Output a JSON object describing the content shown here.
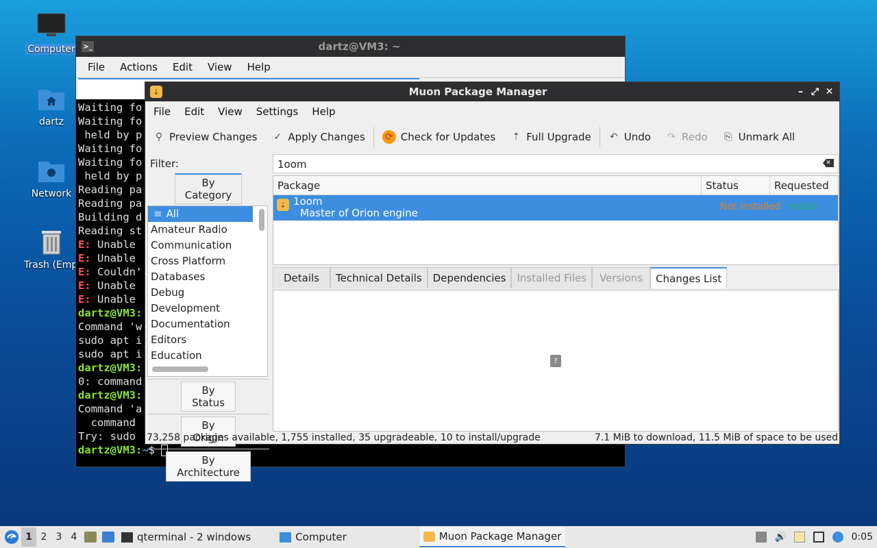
{
  "desktop": {
    "icons": [
      {
        "label": "Computer"
      },
      {
        "label": "dartz"
      },
      {
        "label": "Network"
      },
      {
        "label": "Trash (Empty)"
      }
    ]
  },
  "terminal": {
    "title": "dartz@VM3: ~",
    "menu": [
      "File",
      "Actions",
      "Edit",
      "View",
      "Help"
    ],
    "lines": [
      {
        "type": "plain",
        "text": "Waiting fo"
      },
      {
        "type": "plain",
        "text": "Waiting fo"
      },
      {
        "type": "plain",
        "text": " held by p"
      },
      {
        "type": "plain",
        "text": "Waiting fo"
      },
      {
        "type": "plain",
        "text": "Waiting fo"
      },
      {
        "type": "plain",
        "text": " held by p"
      },
      {
        "type": "plain",
        "text": "Reading pa"
      },
      {
        "type": "plain",
        "text": "Reading pa"
      },
      {
        "type": "plain",
        "text": "Building d"
      },
      {
        "type": "plain",
        "text": "Reading st"
      },
      {
        "type": "err",
        "prefix": "E:",
        "text": " Unable"
      },
      {
        "type": "err",
        "prefix": "E:",
        "text": " Unable"
      },
      {
        "type": "err",
        "prefix": "E:",
        "text": " Couldn'"
      },
      {
        "type": "err",
        "prefix": "E:",
        "text": " Unable"
      },
      {
        "type": "err",
        "prefix": "E:",
        "text": " Unable"
      },
      {
        "type": "prompt",
        "prefix": "dartz@VM3:",
        "text": ""
      },
      {
        "type": "plain",
        "text": "Command 'w"
      },
      {
        "type": "plain",
        "text": "sudo apt i"
      },
      {
        "type": "plain",
        "text": "sudo apt i"
      },
      {
        "type": "prompt",
        "prefix": "dartz@VM3:",
        "text": ""
      },
      {
        "type": "plain",
        "text": "0: command"
      },
      {
        "type": "prompt",
        "prefix": "dartz@VM3:",
        "text": ""
      },
      {
        "type": "plain",
        "text": "Command 'a"
      },
      {
        "type": "plain",
        "text": "  command"
      },
      {
        "type": "plain",
        "text": "Try: sudo"
      }
    ],
    "final_prompt": {
      "user": "dartz@VM3:",
      "path": "~",
      "symbol": "$ "
    }
  },
  "muon": {
    "title": "Muon Package Manager",
    "window_buttons": {
      "min": "–",
      "max": "⤢",
      "close": "✕"
    },
    "menu": [
      "File",
      "Edit",
      "View",
      "Settings",
      "Help"
    ],
    "toolbar": {
      "preview": "Preview Changes",
      "apply": "Apply Changes",
      "check": "Check for Updates",
      "upgrade": "Full Upgrade",
      "undo": "Undo",
      "redo": "Redo",
      "unmark": "Unmark All"
    },
    "filter_label": "Filter:",
    "tabs": {
      "category": "By Category",
      "status": "By Status",
      "origin": "By Origin",
      "arch": "By Architecture"
    },
    "categories": [
      "All",
      "Amateur Radio",
      "Communication",
      "Cross Platform",
      "Databases",
      "Debug",
      "Development",
      "Documentation",
      "Editors",
      "Education"
    ],
    "search_value": "1oom",
    "columns": {
      "package": "Package",
      "status": "Status",
      "requested": "Requested"
    },
    "row": {
      "name": "1oom",
      "description": "Master of Orion engine",
      "status": "Not installed",
      "requested": "Install"
    },
    "detail_tabs": [
      "Details",
      "Technical Details",
      "Dependencies",
      "Installed Files",
      "Versions",
      "Changes List"
    ],
    "statusbar": {
      "left": "73,258 packages available, 1,755 installed, 35 upgradeable, 10 to install/upgrade",
      "right": "7.1 MiB to download, 11.5 MiB of space to be used"
    }
  },
  "taskbar": {
    "workspaces": [
      "1",
      "2",
      "3",
      "4"
    ],
    "tasks": {
      "terminal": "qterminal - 2 windows",
      "computer": "Computer",
      "muon": "Muon Package Manager"
    },
    "clock": "0:05"
  }
}
